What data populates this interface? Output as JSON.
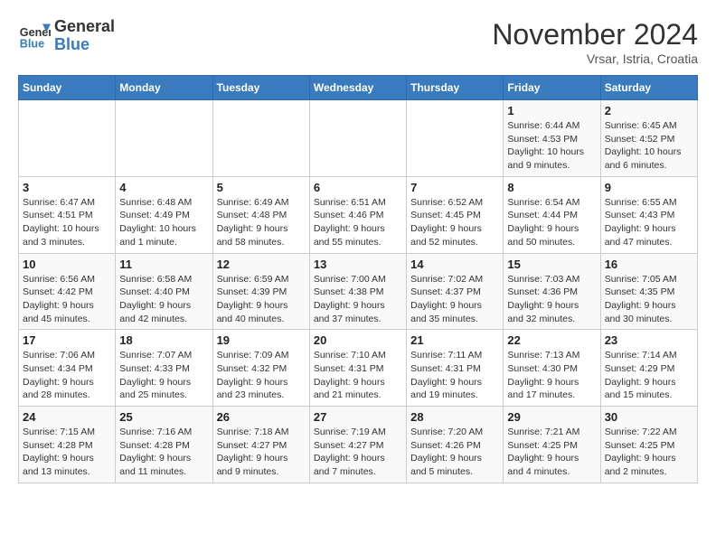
{
  "header": {
    "logo_general": "General",
    "logo_blue": "Blue",
    "month_title": "November 2024",
    "location": "Vrsar, Istria, Croatia"
  },
  "weekdays": [
    "Sunday",
    "Monday",
    "Tuesday",
    "Wednesday",
    "Thursday",
    "Friday",
    "Saturday"
  ],
  "weeks": [
    [
      {
        "day": "",
        "info": ""
      },
      {
        "day": "",
        "info": ""
      },
      {
        "day": "",
        "info": ""
      },
      {
        "day": "",
        "info": ""
      },
      {
        "day": "",
        "info": ""
      },
      {
        "day": "1",
        "info": "Sunrise: 6:44 AM\nSunset: 4:53 PM\nDaylight: 10 hours and 9 minutes."
      },
      {
        "day": "2",
        "info": "Sunrise: 6:45 AM\nSunset: 4:52 PM\nDaylight: 10 hours and 6 minutes."
      }
    ],
    [
      {
        "day": "3",
        "info": "Sunrise: 6:47 AM\nSunset: 4:51 PM\nDaylight: 10 hours and 3 minutes."
      },
      {
        "day": "4",
        "info": "Sunrise: 6:48 AM\nSunset: 4:49 PM\nDaylight: 10 hours and 1 minute."
      },
      {
        "day": "5",
        "info": "Sunrise: 6:49 AM\nSunset: 4:48 PM\nDaylight: 9 hours and 58 minutes."
      },
      {
        "day": "6",
        "info": "Sunrise: 6:51 AM\nSunset: 4:46 PM\nDaylight: 9 hours and 55 minutes."
      },
      {
        "day": "7",
        "info": "Sunrise: 6:52 AM\nSunset: 4:45 PM\nDaylight: 9 hours and 52 minutes."
      },
      {
        "day": "8",
        "info": "Sunrise: 6:54 AM\nSunset: 4:44 PM\nDaylight: 9 hours and 50 minutes."
      },
      {
        "day": "9",
        "info": "Sunrise: 6:55 AM\nSunset: 4:43 PM\nDaylight: 9 hours and 47 minutes."
      }
    ],
    [
      {
        "day": "10",
        "info": "Sunrise: 6:56 AM\nSunset: 4:42 PM\nDaylight: 9 hours and 45 minutes."
      },
      {
        "day": "11",
        "info": "Sunrise: 6:58 AM\nSunset: 4:40 PM\nDaylight: 9 hours and 42 minutes."
      },
      {
        "day": "12",
        "info": "Sunrise: 6:59 AM\nSunset: 4:39 PM\nDaylight: 9 hours and 40 minutes."
      },
      {
        "day": "13",
        "info": "Sunrise: 7:00 AM\nSunset: 4:38 PM\nDaylight: 9 hours and 37 minutes."
      },
      {
        "day": "14",
        "info": "Sunrise: 7:02 AM\nSunset: 4:37 PM\nDaylight: 9 hours and 35 minutes."
      },
      {
        "day": "15",
        "info": "Sunrise: 7:03 AM\nSunset: 4:36 PM\nDaylight: 9 hours and 32 minutes."
      },
      {
        "day": "16",
        "info": "Sunrise: 7:05 AM\nSunset: 4:35 PM\nDaylight: 9 hours and 30 minutes."
      }
    ],
    [
      {
        "day": "17",
        "info": "Sunrise: 7:06 AM\nSunset: 4:34 PM\nDaylight: 9 hours and 28 minutes."
      },
      {
        "day": "18",
        "info": "Sunrise: 7:07 AM\nSunset: 4:33 PM\nDaylight: 9 hours and 25 minutes."
      },
      {
        "day": "19",
        "info": "Sunrise: 7:09 AM\nSunset: 4:32 PM\nDaylight: 9 hours and 23 minutes."
      },
      {
        "day": "20",
        "info": "Sunrise: 7:10 AM\nSunset: 4:31 PM\nDaylight: 9 hours and 21 minutes."
      },
      {
        "day": "21",
        "info": "Sunrise: 7:11 AM\nSunset: 4:31 PM\nDaylight: 9 hours and 19 minutes."
      },
      {
        "day": "22",
        "info": "Sunrise: 7:13 AM\nSunset: 4:30 PM\nDaylight: 9 hours and 17 minutes."
      },
      {
        "day": "23",
        "info": "Sunrise: 7:14 AM\nSunset: 4:29 PM\nDaylight: 9 hours and 15 minutes."
      }
    ],
    [
      {
        "day": "24",
        "info": "Sunrise: 7:15 AM\nSunset: 4:28 PM\nDaylight: 9 hours and 13 minutes."
      },
      {
        "day": "25",
        "info": "Sunrise: 7:16 AM\nSunset: 4:28 PM\nDaylight: 9 hours and 11 minutes."
      },
      {
        "day": "26",
        "info": "Sunrise: 7:18 AM\nSunset: 4:27 PM\nDaylight: 9 hours and 9 minutes."
      },
      {
        "day": "27",
        "info": "Sunrise: 7:19 AM\nSunset: 4:27 PM\nDaylight: 9 hours and 7 minutes."
      },
      {
        "day": "28",
        "info": "Sunrise: 7:20 AM\nSunset: 4:26 PM\nDaylight: 9 hours and 5 minutes."
      },
      {
        "day": "29",
        "info": "Sunrise: 7:21 AM\nSunset: 4:25 PM\nDaylight: 9 hours and 4 minutes."
      },
      {
        "day": "30",
        "info": "Sunrise: 7:22 AM\nSunset: 4:25 PM\nDaylight: 9 hours and 2 minutes."
      }
    ]
  ]
}
